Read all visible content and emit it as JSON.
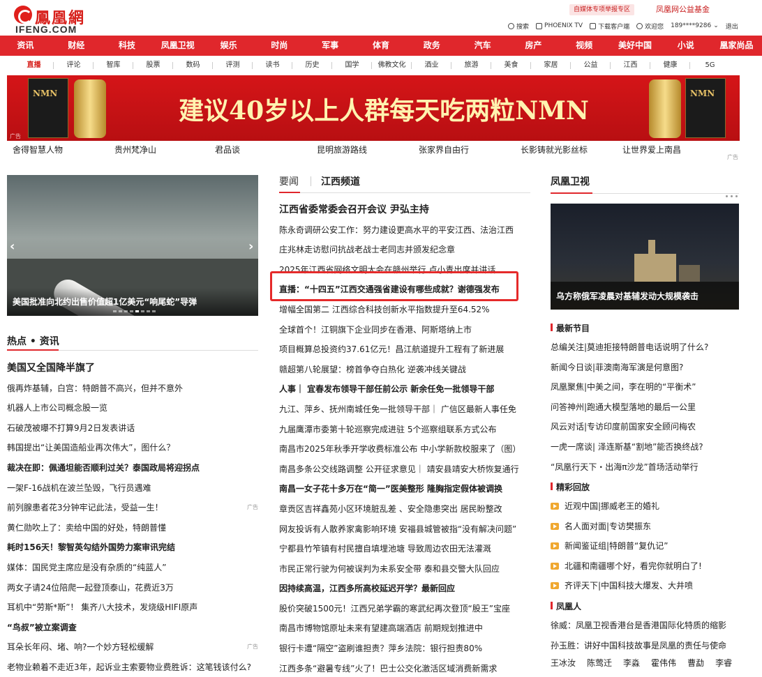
{
  "header": {
    "logo_cn": "鳳凰網",
    "logo_en": "IFENG.COM",
    "promo_badge": "自媒体专项举报专区",
    "promo_fund": "凤凰网公益基金",
    "tools": {
      "search": "搜索",
      "phoenix_tv": "PHOENIX TV",
      "download": "下载客户端",
      "welcome": "欢迎您",
      "user": "189****9286",
      "logout": "退出"
    }
  },
  "main_nav": [
    "资讯",
    "财经",
    "科技",
    "凤凰卫视",
    "娱乐",
    "时尚",
    "军事",
    "体育",
    "政务",
    "汽车",
    "房产",
    "视频",
    "美好中国",
    "小说",
    "凰家尚品"
  ],
  "sub_nav": [
    "直播",
    "评论",
    "智库",
    "股票",
    "数码",
    "评测",
    "读书",
    "历史",
    "国学",
    "佛教文化",
    "酒业",
    "旅游",
    "美食",
    "家居",
    "公益",
    "江西",
    "健康",
    "5G"
  ],
  "banner": {
    "headline": "建议40岁以上人群每天吃两粒NMN",
    "product_text": "NMN",
    "ad_tag": "广告"
  },
  "link_strip": [
    "舍得智慧人物",
    "贵州梵净山",
    "君品谈",
    "昆明旅游路线",
    "张家界自由行",
    "长影铸就光影丝标",
    "让世界爱上南昌"
  ],
  "link_strip_ad": "广告",
  "left": {
    "slider_caption": "美国批准向北约出售价值超1亿美元“响尾蛇”导弹",
    "slider_prev": "‹",
    "slider_next": "›",
    "section_title": "热点 • 资讯",
    "news": [
      {
        "text": "美国又全国降半旗了",
        "style": "big"
      },
      {
        "text": "俄再炸基辅，白宫：特朗普不高兴，但并不意外",
        "style": ""
      },
      {
        "text": "机器人上市公司概念股一览",
        "style": ""
      },
      {
        "text": "石破茂被曝不打算9月2日发表讲话",
        "style": ""
      },
      {
        "text": "韩国提出“让美国造船业再次伟大”，图什么？",
        "style": ""
      },
      {
        "text": "裁决在即：佩通坦能否顺利过关？泰国政局将迎拐点",
        "style": "bold"
      },
      {
        "text": "一架F-16战机在波兰坠毁，飞行员遇难",
        "style": ""
      },
      {
        "text": "前列腺患者花3分钟牢记此法，受益一生！",
        "style": "",
        "ad": "广告"
      },
      {
        "text": "黄仁勋吹上了：卖给中国的好处，特朗普懂",
        "style": ""
      },
      {
        "text": "耗时156天！黎智英勾结外国势力案审讯完结",
        "style": "bold"
      },
      {
        "text": "媒体：国民党主席应是没有杂质的“纯蓝人”",
        "style": ""
      },
      {
        "text": "两女子请24位陪爬一起登顶泰山，花费近3万",
        "style": ""
      },
      {
        "text": "耳机中“劳斯*斯”！ 集齐八大技术，发烧级HIFI原声",
        "style": ""
      },
      {
        "text": "“鸟叔”被立案调查",
        "style": "bold"
      },
      {
        "text": "耳朵长年闷、堵、响?一个妙方轻松缓解",
        "style": "",
        "ad": "广告"
      },
      {
        "text": "老物业赖着不走近3年，起诉业主索要物业费胜诉：这笔钱该付么?",
        "style": ""
      }
    ]
  },
  "middle": {
    "tab_main": "要闻",
    "tab_local": "江西频道",
    "news": [
      {
        "text": "江西省委常委会召开会议 尹弘主持",
        "style": "big"
      },
      {
        "text": "陈永奇调研公安工作：努力建设更高水平的平安江西、法治江西",
        "style": ""
      },
      {
        "text": "庄兆林走访慰问抗战老战士老同志并颁发纪念章",
        "style": ""
      },
      {
        "text": "2025年江西省网络文明大会在赣州举行 卢小青出席并讲话",
        "style": ""
      },
      {
        "text": "直播：“十四五”江西交通强省建设有哪些成就？谢德强发布",
        "style": "bold"
      },
      {
        "text": "增幅全国第二 江西综合科技创新水平指数提升至64.52%",
        "style": ""
      },
      {
        "text": "全球首个！江铜旗下企业同步在香港、阿斯塔纳上市",
        "style": ""
      },
      {
        "text": "项目概算总投资约37.61亿元！昌江航道提升工程有了新进展",
        "style": ""
      },
      {
        "text": "赣超第八轮展望：榜首争夺白热化 逆袭冲线关键战",
        "style": ""
      },
      {
        "text": "人事｜  宜春发布领导干部任前公示   新余任免一批领导干部",
        "style": "bold"
      },
      {
        "text": "九江、萍乡、抚州南城任免一批领导干部｜  广信区最新人事任免",
        "style": ""
      },
      {
        "text": "九届鹰潭市委第十轮巡察完成进驻 5个巡察组联系方式公布",
        "style": ""
      },
      {
        "text": "南昌市2025年秋季开学收费标准公布   中小学新款校服来了（图）",
        "style": ""
      },
      {
        "text": "南昌多条公交线路调整 公开征求意见｜  靖安县靖安大桥恢复通行",
        "style": ""
      },
      {
        "text": "南昌一女子花十多万在“简一”医美整形 隆胸指定假体被调换",
        "style": "bold"
      },
      {
        "text": "章贡区吉祥鑫苑小区环境脏乱差 、安全隐患突出 居民盼整改",
        "style": ""
      },
      {
        "text": "网友投诉有人散养家禽影响环境 安福县城管被指“没有解决问题”",
        "style": ""
      },
      {
        "text": "宁都县竹笮镇有村民擅自填埋池塘 导致周边农田无法灌溉",
        "style": ""
      },
      {
        "text": "市民正常行驶为何被误判为未系安全带 泰和县交警大队回应",
        "style": ""
      },
      {
        "text": "因持续高温，江西多所高校延迟开学？最新回应",
        "style": "bold"
      },
      {
        "text": "股价突破1500元！江西兄弟学霸的寒武纪再次登顶“股王”宝座",
        "style": ""
      },
      {
        "text": "南昌市博物馆原址未来有望建高端酒店 前期规划推进中",
        "style": ""
      },
      {
        "text": "银行卡遭“隔空”盗刷谁担责？萍乡法院：银行担责80%",
        "style": ""
      },
      {
        "text": "江西多条“避暑专线”火了！巴士公交化激活区域消费新需求",
        "style": ""
      }
    ]
  },
  "right": {
    "section_title": "凤凰卫视",
    "video_caption": "乌方称俄军凌晨对基辅发动大规模袭击",
    "latest_title": "最新节目",
    "latest": [
      "总编关注|莫迪拒接特朗普电话说明了什么?",
      "新闻今日谈|菲澳南海军演是何意图?",
      "凤凰聚焦|中美之间，李在明的“平衡术”",
      "问答神州|跑通大模型落地的最后一公里",
      "风云对话|专访印度前国家安全顾问梅农",
      "一虎一席谈| 泽连斯基“割地”能否换终战?",
      "“凤凰行天下・出海π沙龙”首场活动举行"
    ],
    "replay_title": "精彩回放",
    "replay": [
      "近观中国|挪威老王的婚礼",
      "名人面对面|专访樊振东",
      "新闻鉴证组|特朗普“复仇记”",
      "北疆和南疆哪个好，看完你就明白了!",
      "齐评天下|中国科技大爆发、大井喷"
    ],
    "people_title": "凤凰人",
    "people": [
      "徐威：凤凰卫视香港台是香港国际化特质的缩影",
      "孙玉胜：讲好中国科技故事是凤凰的责任与使命"
    ],
    "names": [
      "王冰汝",
      "陈莺迁",
      "李淼",
      "霍伟伟",
      "曹勐",
      "李睿"
    ]
  }
}
